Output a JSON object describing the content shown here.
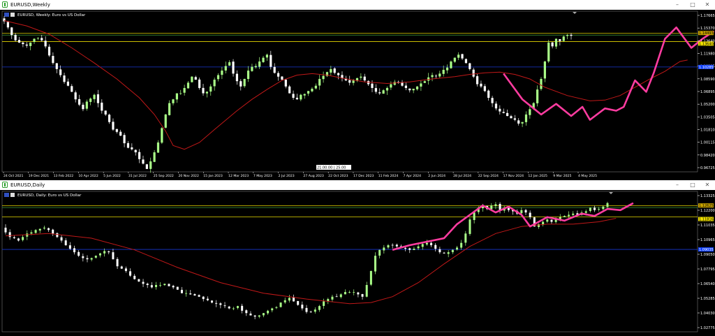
{
  "windows": [
    {
      "title": "EURUSD,Weekly",
      "legend": "EURUSD, Weekly:  Euro vs US Dollar",
      "chart_data": {
        "type": "candlestick",
        "symbol": "EURUSD",
        "timeframe": "Weekly",
        "ylim": [
          0.9642,
          1.1765
        ],
        "y_ticks": [
          "1.17665",
          "1.15370",
          "1.13640",
          "1.11980",
          "1.10285",
          "1.08590",
          "1.06895",
          "1.05200",
          "1.03505",
          "1.01810",
          "1.00115",
          "0.98420",
          "0.96725"
        ],
        "price_labels": [
          {
            "text": "1.14493",
            "value": 1.1449,
            "color": "#c8a200"
          },
          {
            "text": "1.13640",
            "value": 1.1364,
            "color": "#f0e000"
          },
          {
            "text": "1.10285",
            "value": 1.1028,
            "color": "#1040ff"
          }
        ],
        "x_ticks": [
          "24 Oct 2021",
          "19 Dec 2021",
          "13 Feb 2022",
          "10 Apr 2022",
          "5 Jun 2022",
          "31 Jul 2022",
          "25 Sep 2022",
          "20 Nov 2022",
          "15 Jan 2023",
          "12 Mar 2023",
          "7 May 2023",
          "2 Jul 2023",
          "27 Aug 2023",
          "22 Oct 2023",
          "17 Dec 2023",
          "11 Feb 2024",
          "7 Apr 2024",
          "2 Jun 2024",
          "28 Jul 2024",
          "22 Sep 2024",
          "17 Nov 2024",
          "12 Jan 2025",
          "9 Mar 2025",
          "4 May 2025"
        ],
        "cursor_label": "21.00.00 | 25.00",
        "close_path": [
          1.163,
          1.155,
          1.145,
          1.138,
          1.135,
          1.133,
          1.131,
          1.135,
          1.14,
          1.141,
          1.138,
          1.13,
          1.118,
          1.108,
          1.1,
          1.092,
          1.083,
          1.078,
          1.07,
          1.06,
          1.053,
          1.047,
          1.057,
          1.061,
          1.066,
          1.055,
          1.045,
          1.04,
          1.03,
          1.02,
          1.017,
          1.012,
          1.002,
          0.996,
          0.994,
          0.99,
          0.981,
          0.975,
          0.968,
          0.978,
          0.99,
          1.003,
          1.022,
          1.04,
          1.055,
          1.06,
          1.068,
          1.068,
          1.075,
          1.082,
          1.09,
          1.086,
          1.075,
          1.068,
          1.07,
          1.077,
          1.086,
          1.092,
          1.098,
          1.104,
          1.109,
          1.094,
          1.084,
          1.077,
          1.087,
          1.098,
          1.103,
          1.104,
          1.11,
          1.115,
          1.119,
          1.103,
          1.095,
          1.09,
          1.086,
          1.077,
          1.068,
          1.062,
          1.06,
          1.066,
          1.067,
          1.071,
          1.074,
          1.078,
          1.087,
          1.091,
          1.096,
          1.1,
          1.095,
          1.092,
          1.088,
          1.085,
          1.082,
          1.085,
          1.088,
          1.09,
          1.085,
          1.08,
          1.075,
          1.07,
          1.068,
          1.072,
          1.075,
          1.08,
          1.083,
          1.082,
          1.078,
          1.075,
          1.072,
          1.074,
          1.077,
          1.081,
          1.084,
          1.089,
          1.092,
          1.091,
          1.094,
          1.099,
          1.102,
          1.11,
          1.115,
          1.119,
          1.114,
          1.108,
          1.1,
          1.09,
          1.08,
          1.077,
          1.071,
          1.062,
          1.055,
          1.048,
          1.044,
          1.042,
          1.038,
          1.035,
          1.033,
          1.028,
          1.03,
          1.04,
          1.047,
          1.055,
          1.073,
          1.087,
          1.11,
          1.135,
          1.13,
          1.14,
          1.137,
          1.143,
          1.145,
          1.144
        ],
        "zigzag": [
          [
            133,
            1.094
          ],
          [
            138,
            1.06
          ],
          [
            143,
            1.04
          ],
          [
            147,
            1.054
          ],
          [
            151,
            1.038
          ],
          [
            154,
            1.05
          ],
          [
            156,
            1.033
          ],
          [
            160,
            1.048
          ],
          [
            163,
            1.045
          ],
          [
            165,
            1.05
          ],
          [
            168,
            1.085
          ],
          [
            171,
            1.07
          ],
          [
            173,
            1.095
          ],
          [
            176,
            1.14
          ],
          [
            179,
            1.155
          ],
          [
            183,
            1.128
          ],
          [
            186,
            1.14
          ],
          [
            189,
            1.15
          ]
        ],
        "ma": [
          [
            0,
            1.164
          ],
          [
            6,
            1.157
          ],
          [
            12,
            1.146
          ],
          [
            18,
            1.128
          ],
          [
            24,
            1.108
          ],
          [
            30,
            1.087
          ],
          [
            36,
            1.062
          ],
          [
            40,
            1.04
          ],
          [
            43,
            1.018
          ],
          [
            45,
            0.999
          ],
          [
            48,
            0.994
          ],
          [
            52,
            1.003
          ],
          [
            56,
            1.02
          ],
          [
            62,
            1.045
          ],
          [
            66,
            1.06
          ],
          [
            70,
            1.073
          ],
          [
            74,
            1.085
          ],
          [
            78,
            1.092
          ],
          [
            82,
            1.094
          ],
          [
            86,
            1.092
          ],
          [
            90,
            1.088
          ],
          [
            96,
            1.083
          ],
          [
            102,
            1.081
          ],
          [
            108,
            1.083
          ],
          [
            114,
            1.087
          ],
          [
            120,
            1.09
          ],
          [
            124,
            1.093
          ],
          [
            128,
            1.095
          ],
          [
            132,
            1.096
          ],
          [
            136,
            1.093
          ],
          [
            140,
            1.087
          ],
          [
            144,
            1.076
          ],
          [
            150,
            1.065
          ],
          [
            156,
            1.058
          ],
          [
            160,
            1.059
          ],
          [
            164,
            1.065
          ],
          [
            168,
            1.076
          ],
          [
            172,
            1.087
          ],
          [
            176,
            1.097
          ],
          [
            180,
            1.11
          ],
          [
            182,
            1.112
          ]
        ]
      }
    },
    {
      "title": "EURUSD,Daily",
      "legend": "EURUSD, Daily:  Euro vs US Dollar",
      "chart_data": {
        "type": "candlestick",
        "symbol": "EURUSD",
        "timeframe": "Daily",
        "ylim": [
          1.02,
          1.14
        ],
        "y_ticks": [
          "1.13325",
          "1.12200",
          "1.11035",
          "1.10965",
          "1.09050",
          "1.07795",
          "1.06540",
          "1.05285",
          "1.04030",
          "1.02775"
        ],
        "price_labels": [
          {
            "text": "1.12625",
            "value": 1.1262,
            "color": "#c8a200"
          },
          {
            "text": "1.11816",
            "value": 1.1182,
            "color": "#f0e000"
          },
          {
            "text": "1.09035",
            "value": 1.0904,
            "color": "#1040ff"
          }
        ],
        "close_path": [
          1.105,
          1.101,
          1.1,
          1.098,
          1.101,
          1.104,
          1.105,
          1.107,
          1.108,
          1.109,
          1.107,
          1.104,
          1.101,
          1.098,
          1.094,
          1.091,
          1.088,
          1.085,
          1.083,
          1.082,
          1.083,
          1.085,
          1.087,
          1.089,
          1.088,
          1.082,
          1.076,
          1.074,
          1.072,
          1.068,
          1.065,
          1.063,
          1.061,
          1.06,
          1.058,
          1.06,
          1.06,
          1.061,
          1.059,
          1.058,
          1.056,
          1.053,
          1.053,
          1.052,
          1.051,
          1.05,
          1.048,
          1.047,
          1.045,
          1.044,
          1.043,
          1.042,
          1.04,
          1.04,
          1.042,
          1.038,
          1.036,
          1.034,
          1.033,
          1.034,
          1.036,
          1.038,
          1.04,
          1.041,
          1.045,
          1.047,
          1.049,
          1.046,
          1.043,
          1.04,
          1.037,
          1.037,
          1.039,
          1.042,
          1.046,
          1.048,
          1.05,
          1.05,
          1.052,
          1.054,
          1.054,
          1.054,
          1.052,
          1.05,
          1.06,
          1.072,
          1.085,
          1.09,
          1.092,
          1.094,
          1.094,
          1.093,
          1.092,
          1.091,
          1.09,
          1.091,
          1.093,
          1.095,
          1.096,
          1.094,
          1.091,
          1.088,
          1.087,
          1.088,
          1.09,
          1.092,
          1.096,
          1.104,
          1.116,
          1.122,
          1.126,
          1.128,
          1.125,
          1.128,
          1.129,
          1.124,
          1.126,
          1.124,
          1.123,
          1.121,
          1.124,
          1.122,
          1.118,
          1.11,
          1.112,
          1.114,
          1.116,
          1.114,
          1.116,
          1.118,
          1.119,
          1.12,
          1.121,
          1.12,
          1.122,
          1.123,
          1.126,
          1.124,
          1.125,
          1.127,
          1.13
        ],
        "zigzag": [
          [
            90,
            1.09
          ],
          [
            94,
            1.094
          ],
          [
            98,
            1.097
          ],
          [
            102,
            1.1
          ],
          [
            105,
            1.112
          ],
          [
            108,
            1.12
          ],
          [
            111,
            1.128
          ],
          [
            114,
            1.122
          ],
          [
            117,
            1.127
          ],
          [
            120,
            1.12
          ],
          [
            122,
            1.11
          ],
          [
            126,
            1.118
          ],
          [
            130,
            1.115
          ],
          [
            134,
            1.121
          ],
          [
            137,
            1.119
          ],
          [
            140,
            1.125
          ],
          [
            143,
            1.124
          ],
          [
            146,
            1.13
          ]
        ],
        "ma": [
          [
            0,
            1.102
          ],
          [
            10,
            1.104
          ],
          [
            20,
            1.1
          ],
          [
            30,
            1.09
          ],
          [
            40,
            1.075
          ],
          [
            50,
            1.062
          ],
          [
            60,
            1.053
          ],
          [
            70,
            1.048
          ],
          [
            80,
            1.044
          ],
          [
            85,
            1.045
          ],
          [
            90,
            1.05
          ],
          [
            96,
            1.062
          ],
          [
            102,
            1.078
          ],
          [
            108,
            1.093
          ],
          [
            114,
            1.104
          ],
          [
            120,
            1.11
          ],
          [
            126,
            1.112
          ],
          [
            132,
            1.112
          ],
          [
            138,
            1.114
          ],
          [
            142,
            1.117
          ]
        ]
      }
    }
  ],
  "colors": {
    "background": "#000000",
    "bull": "#aaff88",
    "bear": "#ffffff",
    "ma": "#c01818",
    "zigzag": "#ff3ca0",
    "hline_yellow": "#e6d800",
    "hline_green": "#3a9a3a",
    "hline_blue": "#1838d0",
    "grid_text": "#ffffff"
  },
  "icons": {
    "app_icon": "chart-window-icon",
    "minimize": "minimize-icon",
    "maximize": "maximize-icon",
    "close": "close-icon"
  }
}
